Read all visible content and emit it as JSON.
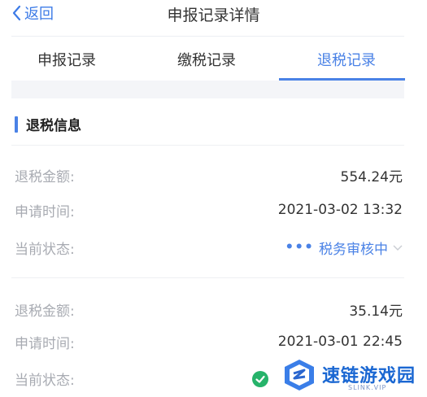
{
  "header": {
    "back_label": "返回",
    "title": "申报记录详情"
  },
  "tabs": [
    {
      "label": "申报记录",
      "active": false
    },
    {
      "label": "缴税记录",
      "active": false
    },
    {
      "label": "退税记录",
      "active": true
    }
  ],
  "section": {
    "title": "退税信息"
  },
  "records": [
    {
      "amount_label": "退税金额:",
      "amount": "554.24元",
      "time_label": "申请时间:",
      "time": "2021-03-02 13:32",
      "status_label": "当前状态:",
      "status": "税务审核中",
      "status_icon": "dots-icon"
    },
    {
      "amount_label": "退税金额:",
      "amount": "35.14元",
      "time_label": "申请时间:",
      "time": "2021-03-01 22:45",
      "status_label": "当前状态:",
      "status_icon": "check-circle-icon"
    }
  ],
  "watermark": {
    "text": "速链游戏园",
    "url": "SLINK.VIP"
  },
  "colors": {
    "accent": "#4a82e6",
    "label": "#a8abb2",
    "success": "#26b36a",
    "watermark": "#1a67d2"
  }
}
